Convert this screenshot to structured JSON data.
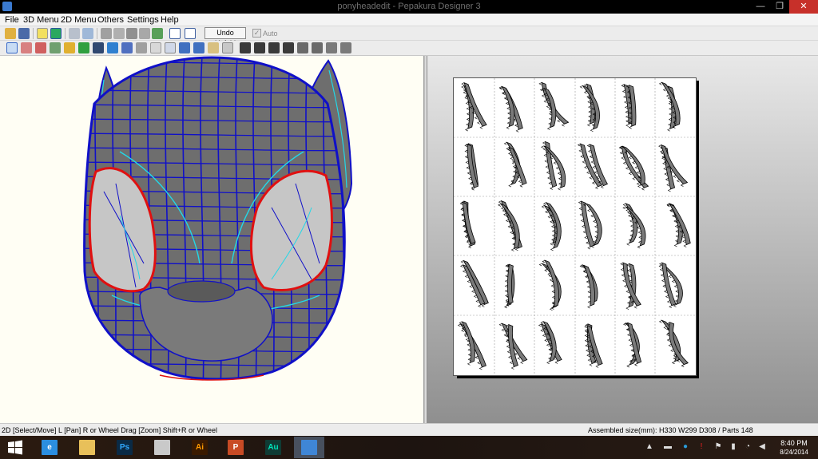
{
  "window": {
    "title": "ponyheadedit - Pepakura Designer 3",
    "minimize": "—",
    "maximize": "❐",
    "close": "✕"
  },
  "menu": [
    "File",
    "3D Menu",
    "2D Menu",
    "Others",
    "Settings",
    "Help"
  ],
  "toolbar": {
    "undo_unfold": "Undo Unfold",
    "auto_label": "Auto",
    "auto_checked": true,
    "auto_mark": "✓"
  },
  "status": {
    "left": "2D [Select/Move] L [Pan] R or Wheel Drag [Zoom] Shift+R or Wheel",
    "right": "Assembled size(mm): H330 W299 D308 / Parts 148"
  },
  "taskbar": {
    "apps": [
      {
        "name": "internet-explorer",
        "glyph": "e",
        "color": "#2b8ee0",
        "fg": "#fff"
      },
      {
        "name": "file-explorer",
        "glyph": "",
        "color": "#e8c05a",
        "fg": "#000"
      },
      {
        "name": "photoshop",
        "glyph": "Ps",
        "color": "#0a2a45",
        "fg": "#31a8ff"
      },
      {
        "name": "calculator",
        "glyph": "",
        "color": "#c9c9c9",
        "fg": "#000"
      },
      {
        "name": "illustrator",
        "glyph": "Ai",
        "color": "#3a1a00",
        "fg": "#ff9a00"
      },
      {
        "name": "powerpoint",
        "glyph": "P",
        "color": "#c84b25",
        "fg": "#fff"
      },
      {
        "name": "audition",
        "glyph": "Au",
        "color": "#0f3b34",
        "fg": "#00e4bb"
      },
      {
        "name": "pepakura",
        "glyph": "",
        "color": "#3f86d6",
        "fg": "#fff"
      }
    ],
    "clock_time": "8:40 PM",
    "clock_date": "8/24/2014"
  },
  "colors": {
    "mesh_fill": "#6e6e6e",
    "mesh_blue": "#1010c8",
    "mesh_cyan": "#22d8e8",
    "eye_red": "#e01010",
    "eye_fill": "#c6c6c6"
  }
}
